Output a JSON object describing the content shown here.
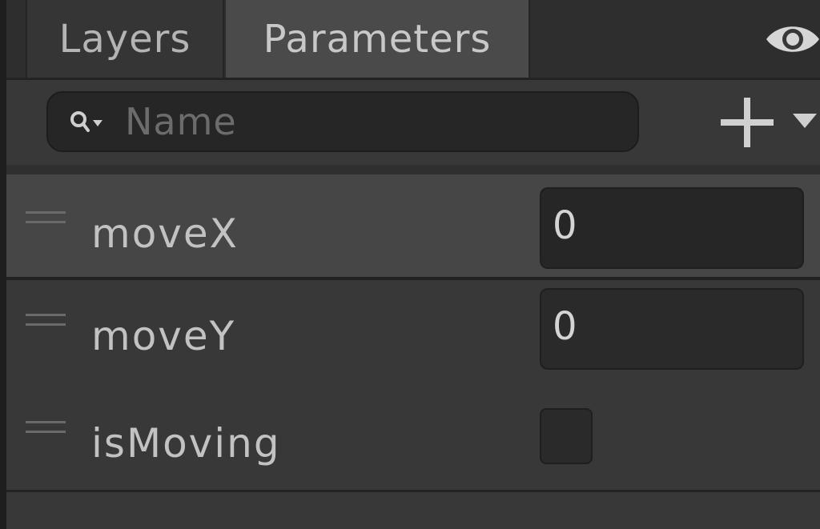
{
  "tabs": [
    {
      "label": "Layers"
    },
    {
      "label": "Parameters"
    }
  ],
  "search": {
    "placeholder": "Name",
    "value": ""
  },
  "parameters": [
    {
      "name": "moveX",
      "type": "float",
      "value": "0"
    },
    {
      "name": "moveY",
      "type": "float",
      "value": "0"
    },
    {
      "name": "isMoving",
      "type": "bool",
      "checked": false
    }
  ],
  "icons": {
    "visibility": "eye-icon",
    "search": "search-icon",
    "add": "plus-icon",
    "dropdown": "chevron-down-icon",
    "handle": "drag-handle-icon"
  },
  "colors": {
    "background": "#383838",
    "tab_active": "#4a4a4a",
    "row_selected": "#464646",
    "field": "#2a2a2a",
    "text": "#c2c2c2"
  }
}
